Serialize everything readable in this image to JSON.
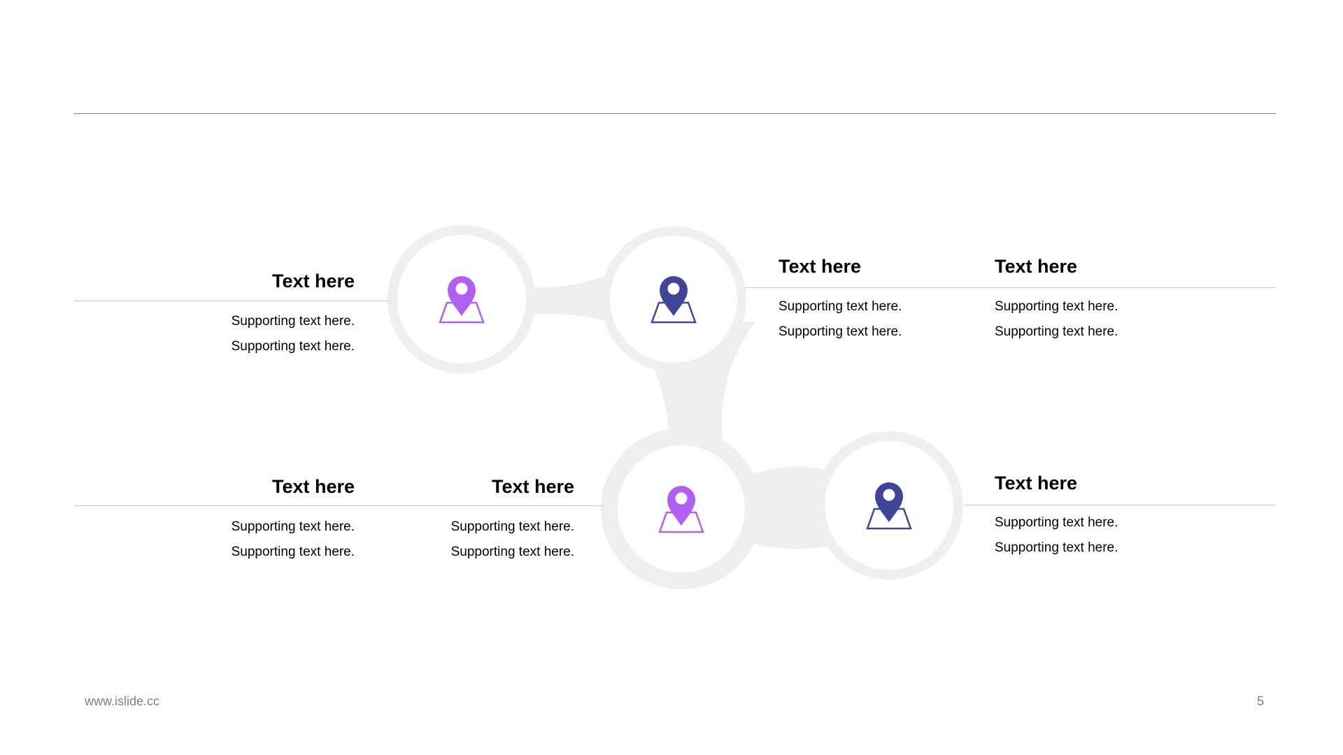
{
  "colors": {
    "accent_purple": "#B15FF2",
    "accent_navy": "#3F4499",
    "connector_gray": "#EFEFEF",
    "rule_gray": "#C8C8C8"
  },
  "nodes": [
    {
      "icon": "location-pin-icon",
      "color": "#B15FF2"
    },
    {
      "icon": "location-pin-icon",
      "color": "#3F4499"
    },
    {
      "icon": "location-pin-icon",
      "color": "#B15FF2"
    },
    {
      "icon": "location-pin-icon",
      "color": "#3F4499"
    }
  ],
  "blocks": [
    {
      "title": "Text here",
      "line1": "Supporting  text here.",
      "line2": "Supporting  text here."
    },
    {
      "title": "Text here",
      "line1": "Supporting  text here.",
      "line2": "Supporting  text here."
    },
    {
      "title": "Text here",
      "line1": "Supporting  text here.",
      "line2": "Supporting  text here."
    },
    {
      "title": "Text here",
      "line1": "Supporting  text here.",
      "line2": "Supporting  text here."
    },
    {
      "title": "Text here",
      "line1": "Supporting  text here.",
      "line2": "Supporting  text here."
    },
    {
      "title": "Text here",
      "line1": "Supporting  text here.",
      "line2": "Supporting  text here."
    }
  ],
  "footer": {
    "website": "www.islide.cc",
    "page_number": "5"
  }
}
